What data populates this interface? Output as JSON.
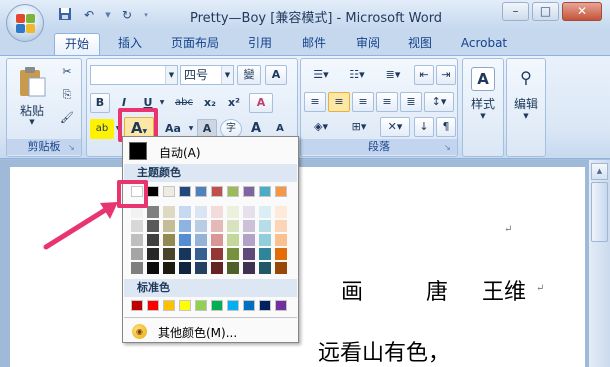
{
  "window": {
    "title": "Pretty—Boy [兼容模式] - Microsoft Word",
    "controls": [
      "–",
      "□",
      "✕"
    ]
  },
  "quick_access": {
    "icons": [
      "save-icon",
      "undo-icon",
      "redo-icon",
      "customize-icon"
    ]
  },
  "tabs": [
    {
      "label": "开始",
      "active": true
    },
    {
      "label": "插入"
    },
    {
      "label": "页面布局"
    },
    {
      "label": "引用"
    },
    {
      "label": "邮件"
    },
    {
      "label": "审阅"
    },
    {
      "label": "视图"
    },
    {
      "label": "Acrobat"
    }
  ],
  "clipboard": {
    "paste_label": "粘贴",
    "group_label": "剪贴板"
  },
  "font": {
    "font_name": "",
    "font_size": "四号",
    "wen_label": "變",
    "border_a": "A",
    "bold": "B",
    "italic": "I",
    "underline": "U",
    "strike": "abc",
    "subscript": "x₂",
    "superscript": "x²",
    "clear_format": "A",
    "highlight": "ab",
    "font_color": "A",
    "change_case": "Aa",
    "shade_a": "A",
    "enclose": "字",
    "grow": "A",
    "shrink": "A"
  },
  "paragraph": {
    "group_label": "段落"
  },
  "styles": {
    "label": "样式"
  },
  "editing": {
    "label": "编辑"
  },
  "color_dropdown": {
    "auto_label": "自动(A)",
    "theme_header": "主题颜色",
    "standard_header": "标准色",
    "more_label": "其他颜色(M)...",
    "theme_colors": [
      "#ffffff",
      "#000000",
      "#eeece1",
      "#1f497d",
      "#4f81bd",
      "#c0504d",
      "#9bbb59",
      "#8064a2",
      "#4bacc6",
      "#f79646"
    ],
    "theme_shades": [
      [
        "#f2f2f2",
        "#7f7f7f",
        "#ddd9c3",
        "#c6d9f0",
        "#dbe5f1",
        "#f2dcdb",
        "#ebf1dd",
        "#e5e0ec",
        "#dbeef3",
        "#fdeada"
      ],
      [
        "#d8d8d8",
        "#595959",
        "#c4bd97",
        "#8db3e2",
        "#b8cce4",
        "#e5b9b7",
        "#d7e3bc",
        "#ccc1d9",
        "#b7dde8",
        "#fbd5b5"
      ],
      [
        "#bfbfbf",
        "#3f3f3f",
        "#938953",
        "#548dd4",
        "#95b3d7",
        "#d99694",
        "#c3d69b",
        "#b2a2c7",
        "#92cddc",
        "#fac08f"
      ],
      [
        "#a5a5a5",
        "#262626",
        "#494429",
        "#17365d",
        "#366092",
        "#953734",
        "#76923c",
        "#5f497a",
        "#31859b",
        "#e36c09"
      ],
      [
        "#7f7f7f",
        "#0c0c0c",
        "#1d1b10",
        "#0f243e",
        "#244061",
        "#632423",
        "#4f6128",
        "#3f3151",
        "#205867",
        "#974806"
      ]
    ],
    "standard_colors": [
      "#c00000",
      "#ff0000",
      "#ffc000",
      "#ffff00",
      "#92d050",
      "#00b050",
      "#00b0f0",
      "#0070c0",
      "#002060",
      "#7030a0"
    ]
  },
  "document": {
    "line1_a": "画",
    "line1_b": "唐",
    "line1_c": "王维",
    "line2": "远看山有色，",
    "para_mark": "↵"
  },
  "colors": {
    "annotation": "#e8356f"
  }
}
